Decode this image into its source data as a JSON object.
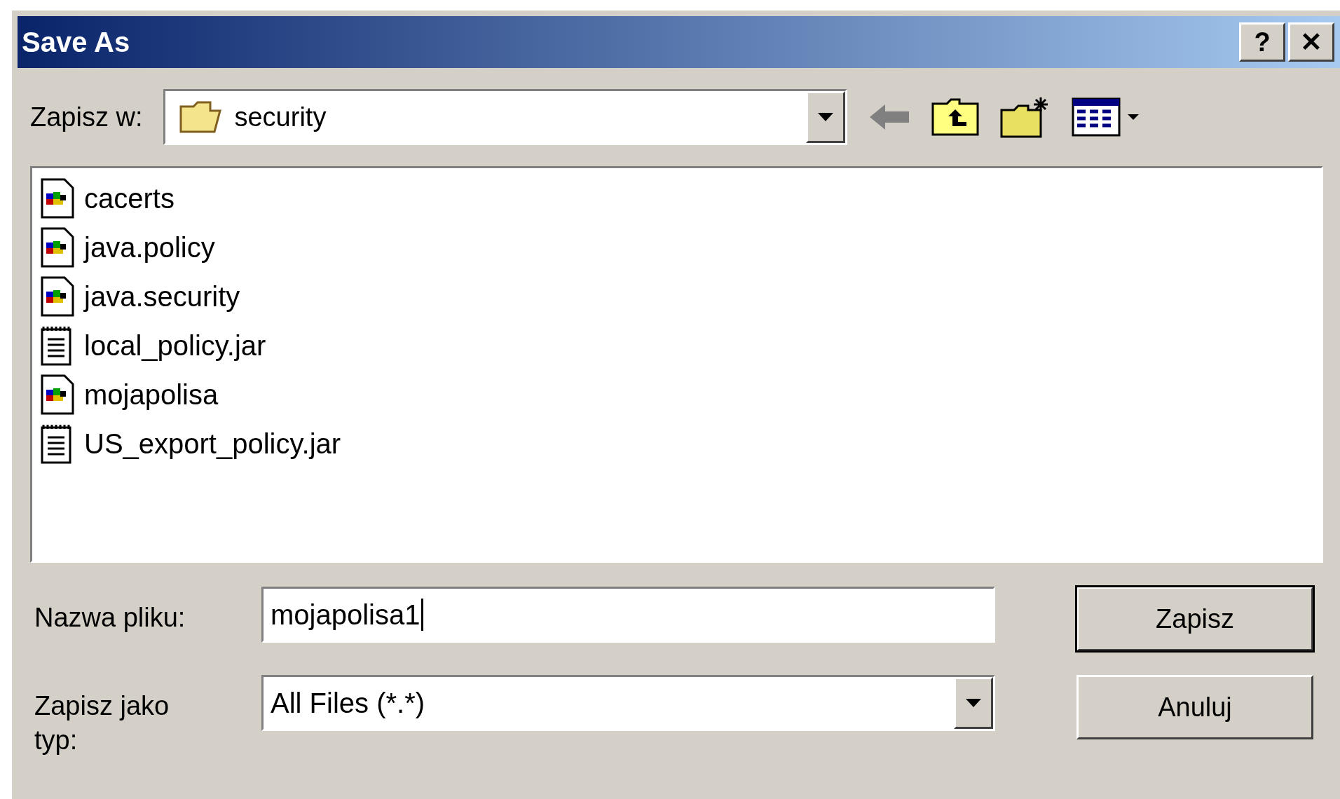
{
  "window": {
    "title": "Save As",
    "buttons": [
      "?",
      "✕"
    ]
  },
  "location": {
    "label": "Zapisz w:",
    "folder": "security"
  },
  "files": [
    {
      "name": "cacerts",
      "kind": "app"
    },
    {
      "name": "java.policy",
      "kind": "app"
    },
    {
      "name": "java.security",
      "kind": "app"
    },
    {
      "name": "local_policy.jar",
      "kind": "text"
    },
    {
      "name": "mojapolisa",
      "kind": "app"
    },
    {
      "name": "US_export_policy.jar",
      "kind": "text"
    }
  ],
  "filename": {
    "label": "Nazwa pliku:",
    "value": "mojapolisa1"
  },
  "filetype": {
    "label": "Zapisz jako typ:",
    "value": "All Files (*.*)"
  },
  "buttons": [
    {
      "label": "Zapisz",
      "default": true
    },
    {
      "label": "Anuluj",
      "default": false
    }
  ]
}
